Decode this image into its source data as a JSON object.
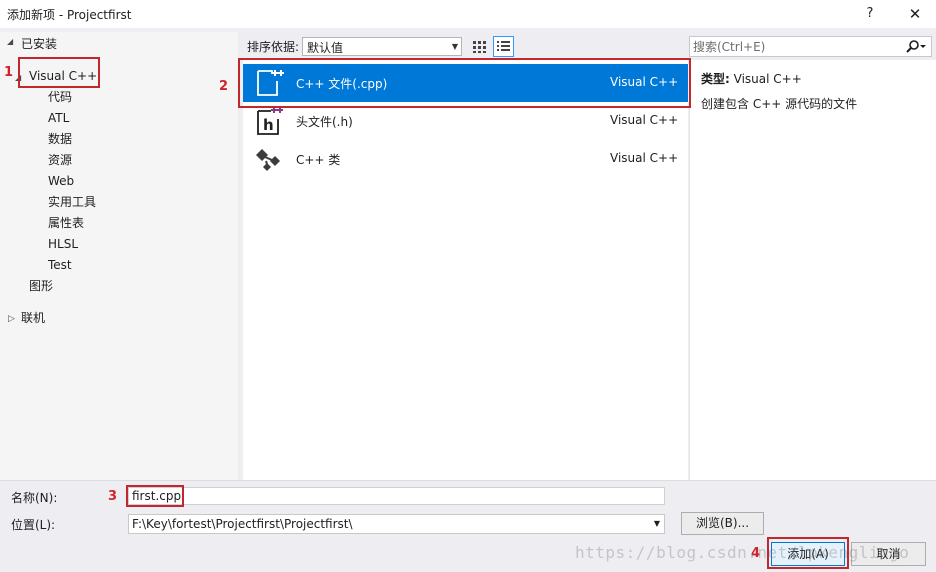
{
  "window": {
    "title": "添加新项 - Projectfirst",
    "help_label": "?",
    "close_label": "✕"
  },
  "tree": {
    "installed_label": "已安装",
    "visual_cpp_label": "Visual C++",
    "children": [
      "代码",
      "ATL",
      "数据",
      "资源",
      "Web",
      "实用工具",
      "属性表",
      "HLSL",
      "Test"
    ],
    "graphics_label": "图形",
    "online_label": "联机"
  },
  "toolbar": {
    "sort_label": "排序依据:",
    "sort_value": "默认值"
  },
  "search": {
    "placeholder": "搜索(Ctrl+E)"
  },
  "templates": [
    {
      "name": "C++ 文件(.cpp)",
      "language": "Visual C++",
      "icon": "cpp-file-icon",
      "selected": true
    },
    {
      "name": "头文件(.h)",
      "language": "Visual C++",
      "icon": "header-file-icon",
      "selected": false
    },
    {
      "name": "C++ 类",
      "language": "Visual C++",
      "icon": "cpp-class-icon",
      "selected": false
    }
  ],
  "details": {
    "type_label": "类型:",
    "type_value": "Visual C++",
    "description": "创建包含 C++ 源代码的文件"
  },
  "form": {
    "name_label": "名称(N):",
    "name_value": "first.cpp",
    "location_label": "位置(L):",
    "location_value": "F:\\Key\\fortest\\Projectfirst\\Projectfirst\\",
    "browse_label": "浏览(B)...",
    "add_label": "添加(A)",
    "cancel_label": "取消"
  },
  "annotations": {
    "step1": "1",
    "step2": "2",
    "step3": "3",
    "step4": "4",
    "color": "#c0282d"
  },
  "watermark": "https://blog.csdn.net/lpkenglingo",
  "colors": {
    "accent": "#0078d7",
    "selection_text": "#ffffff"
  }
}
